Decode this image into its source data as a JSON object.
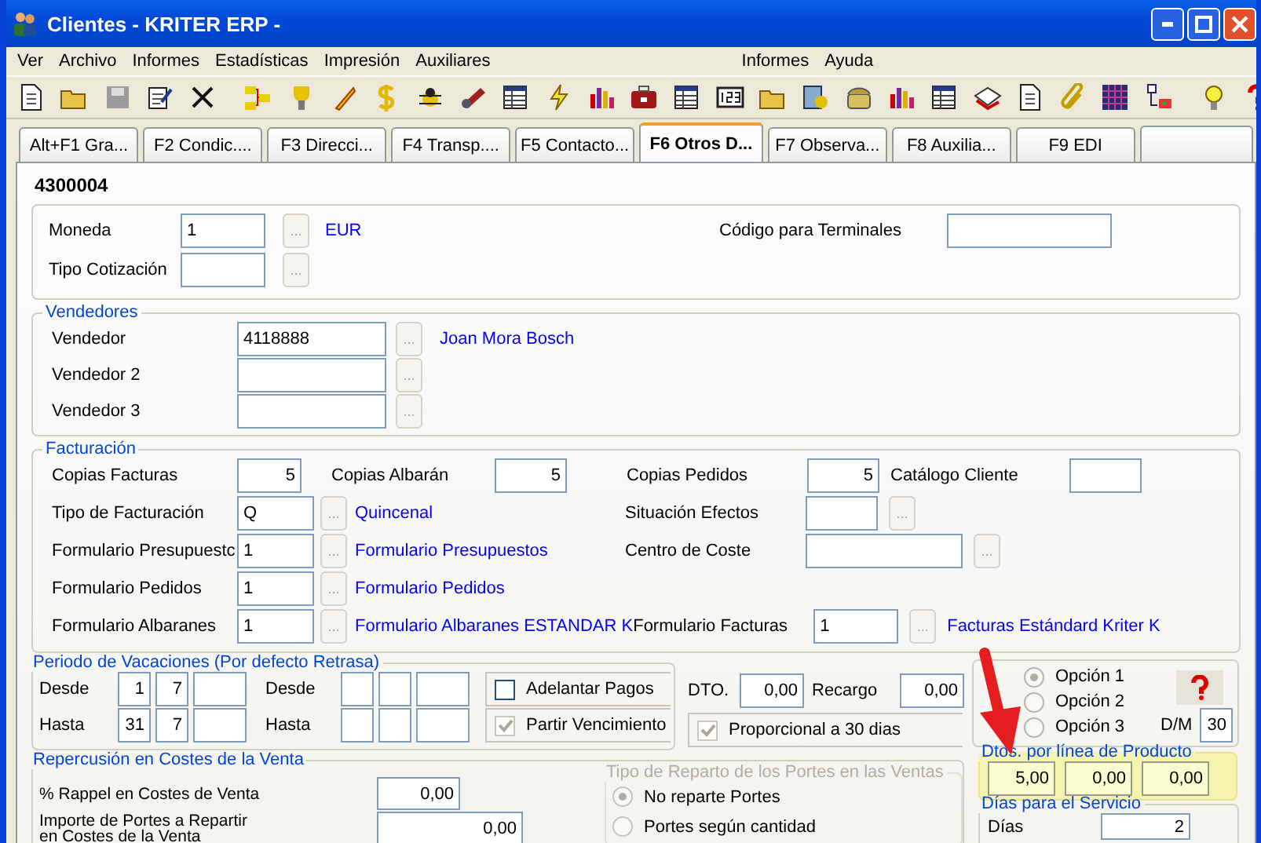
{
  "window": {
    "title": "Clientes - KRITER ERP -"
  },
  "menu": [
    "Ver",
    "Archivo",
    "Informes",
    "Estadísticas",
    "Impresión",
    "Auxiliares",
    "Informes",
    "Ayuda"
  ],
  "tabs": [
    {
      "label": "Alt+F1 Gra...",
      "selected": false
    },
    {
      "label": "F2 Condic....",
      "selected": false
    },
    {
      "label": "F3 Direcci...",
      "selected": false
    },
    {
      "label": "F4 Transp....",
      "selected": false
    },
    {
      "label": "F5 Contacto...",
      "selected": false
    },
    {
      "label": "F6 Otros D...",
      "selected": true
    },
    {
      "label": "F7 Observa...",
      "selected": false
    },
    {
      "label": "F8 Auxilia...",
      "selected": false
    },
    {
      "label": "F9 EDI",
      "selected": false
    }
  ],
  "record": {
    "code": "4300004"
  },
  "general": {
    "moneda": {
      "label": "Moneda",
      "value": "1",
      "button": "...",
      "link": "EUR"
    },
    "tipo_cotizacion": {
      "label": "Tipo Cotización",
      "button": "..."
    },
    "codigo_terminales": {
      "label": "Código para Terminales"
    }
  },
  "vendedores": {
    "title": "Vendedores",
    "rows": [
      {
        "label": "Vendedor",
        "value": "4118888",
        "button": "...",
        "link": "Joan Mora Bosch"
      },
      {
        "label": "Vendedor 2",
        "button": "..."
      },
      {
        "label": "Vendedor 3",
        "button": "..."
      }
    ]
  },
  "facturacion": {
    "title": "Facturación",
    "copias": [
      {
        "label": "Copias Facturas",
        "value": "5"
      },
      {
        "label": "Copias Albarán",
        "value": "5"
      },
      {
        "label": "Copias Pedidos",
        "value": "5"
      },
      {
        "label": "Catálogo Cliente"
      }
    ],
    "left": [
      {
        "label": "Tipo de Facturación",
        "value": "Q",
        "button": "...",
        "link": "Quincenal"
      },
      {
        "label": "Formulario Presupuestc",
        "value": "1",
        "button": "...",
        "link": "Formulario Presupuestos"
      },
      {
        "label": "Formulario Pedidos",
        "value": "1",
        "button": "...",
        "link": "Formulario Pedidos"
      },
      {
        "label": "Formulario Albaranes",
        "value": "1",
        "button": "...",
        "link": "Formulario Albaranes ESTANDAR K"
      }
    ],
    "right": [
      {
        "label": "Situación Efectos",
        "button": "..."
      },
      {
        "label": "Centro de Coste",
        "button": "..."
      },
      {
        "label": "Formulario Facturas",
        "value": "1",
        "button": "...",
        "link": "Facturas Estándard Kriter K"
      }
    ]
  },
  "vacaciones": {
    "title": "Periodo de Vacaciones (Por defecto Retrasa)",
    "periods": [
      [
        {
          "label": "Desde",
          "day": "1",
          "month": "7"
        },
        {
          "label": "Hasta",
          "day": "31",
          "month": "7"
        }
      ],
      [
        {
          "label": "Desde"
        },
        {
          "label": "Hasta"
        }
      ]
    ]
  },
  "pagos": [
    {
      "label": "Adelantar Pagos",
      "checked": false,
      "disabled": false
    },
    {
      "label": "Partir Vencimiento",
      "checked": true,
      "disabled": true
    }
  ],
  "descuento": {
    "dto": {
      "label": "DTO.",
      "value": "0,00"
    },
    "recargo": {
      "label": "Recargo",
      "value": "0,00"
    },
    "proporcional": {
      "label": "Proporcional a 30 dias",
      "checked": true,
      "disabled": true
    }
  },
  "opciones": {
    "radios": [
      {
        "label": "Opción 1",
        "selected": true
      },
      {
        "label": "Opción 2",
        "selected": false
      },
      {
        "label": "Opción 3",
        "selected": false
      }
    ],
    "dm": {
      "label": "D/M",
      "value": "30"
    }
  },
  "dtos_linea": {
    "title": "Dtos. por línea de Producto",
    "highlighted": true,
    "values": [
      "5,00",
      "0,00",
      "0,00"
    ]
  },
  "dias_servicio": {
    "title": "Días para el Servicio",
    "label": "Días",
    "value": "2"
  },
  "repercusion": {
    "title": "Repercusión en Costes de la Venta",
    "rows": [
      {
        "label": "% Rappel en Costes de Venta",
        "value": "0,00"
      },
      {
        "label": "Importe de Portes a Repartir\nen Costes de la Venta",
        "value": "0,00"
      }
    ]
  },
  "reparto": {
    "title": "Tipo de Reparto de los Portes en las Ventas",
    "disabled": true,
    "radios": [
      {
        "label": "No reparte Portes",
        "selected": true
      },
      {
        "label": "Portes según cantidad",
        "selected": false
      }
    ]
  }
}
